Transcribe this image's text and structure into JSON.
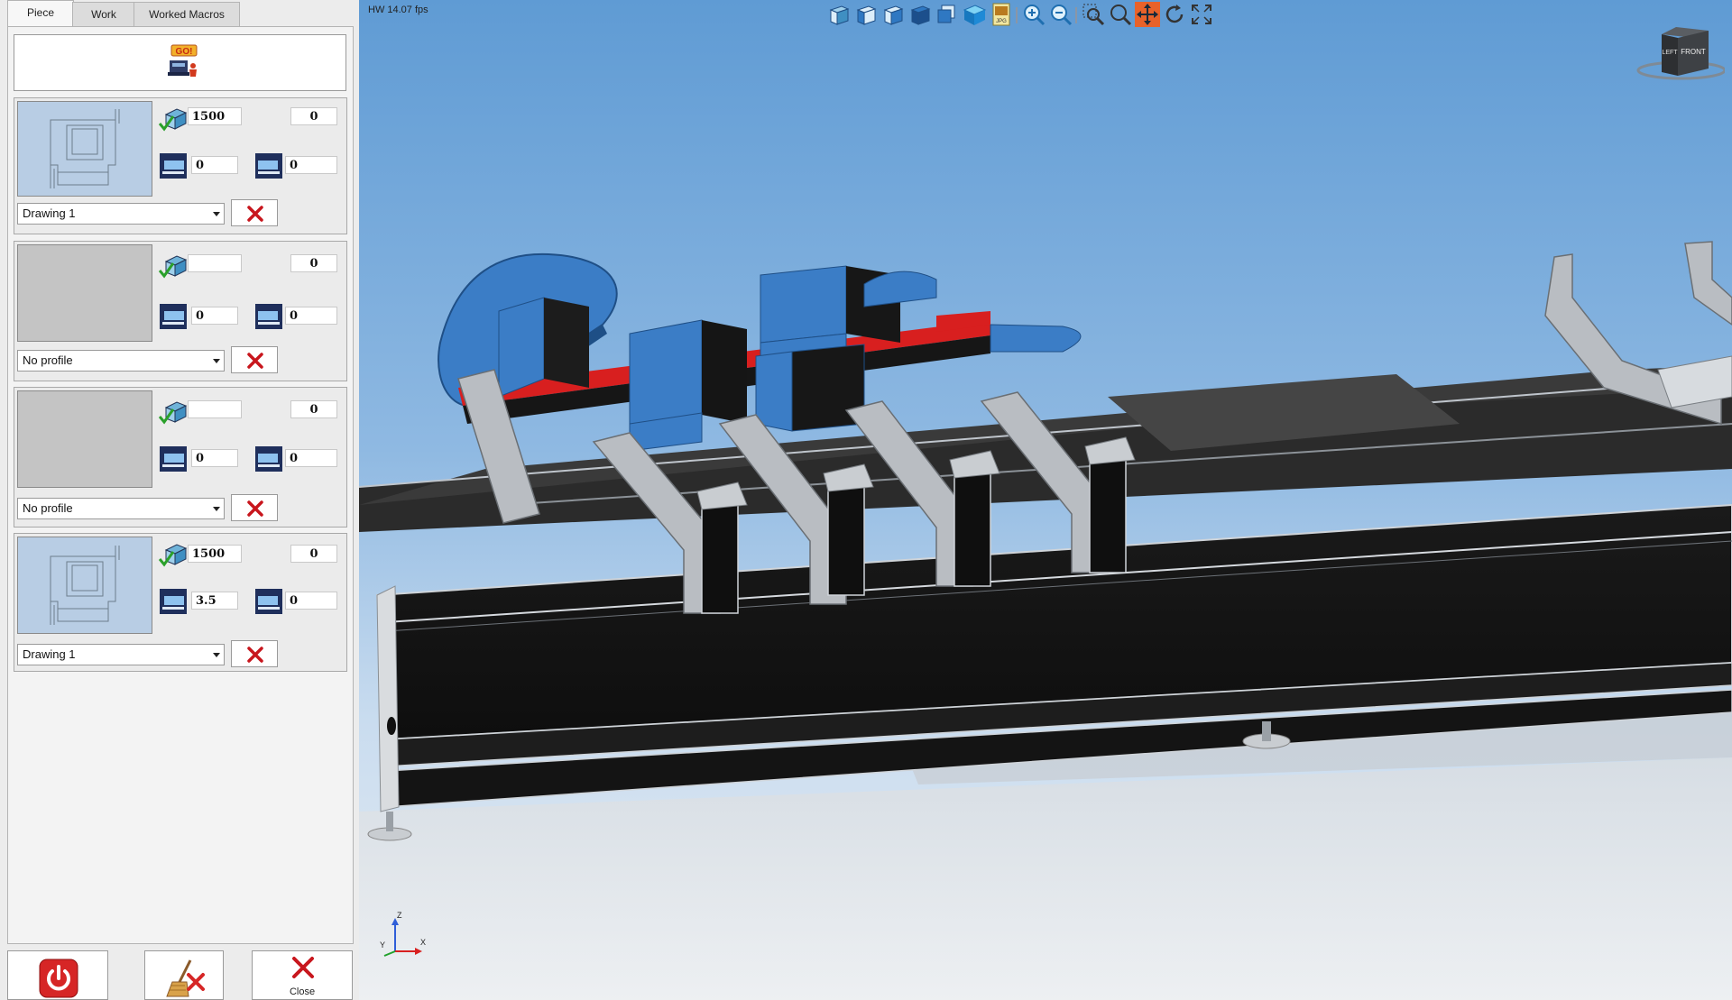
{
  "tabs": [
    "Piece",
    "Work",
    "Worked Macros"
  ],
  "go_panel": {
    "icon": "go-machine-icon"
  },
  "pieces": [
    {
      "thumbnail": "drawn",
      "length": "1500",
      "top_right": "0",
      "left_offset": "0",
      "right_offset": "0",
      "profile": "Drawing 1"
    },
    {
      "thumbnail": "empty",
      "length": "",
      "top_right": "0",
      "left_offset": "0",
      "right_offset": "0",
      "profile": "No profile"
    },
    {
      "thumbnail": "empty",
      "length": "",
      "top_right": "0",
      "left_offset": "0",
      "right_offset": "0",
      "profile": "No profile"
    },
    {
      "thumbnail": "drawn",
      "length": "1500",
      "top_right": "0",
      "left_offset": "3.5",
      "right_offset": "0",
      "profile": "Drawing 1"
    }
  ],
  "bottom_buttons": {
    "power": "",
    "clear": "",
    "close": "Close"
  },
  "viewport": {
    "fps": "HW 14.07 fps",
    "navcube_label": "FRONT",
    "navcube_side": "LEFT",
    "axes": {
      "x": "X",
      "y": "Y",
      "z": "Z"
    },
    "toolbar": [
      "view-iso-icon",
      "view-left-icon",
      "view-right-icon",
      "view-top-icon",
      "view-bottom-icon",
      "view-solid-icon",
      "export-jpg-icon",
      "zoom-in-icon",
      "zoom-out-icon",
      "zoom-window-icon",
      "zoom-fit-icon",
      "pan-icon",
      "rotate-icon",
      "fullscreen-icon"
    ],
    "active_tool": "pan-icon",
    "jpg_label": "JPG"
  },
  "colors": {
    "accent_active_tool": "#e8622a",
    "delete_red": "#c8161d",
    "part_blue": "#3b7dc6",
    "rail_red": "#d81f1f"
  }
}
